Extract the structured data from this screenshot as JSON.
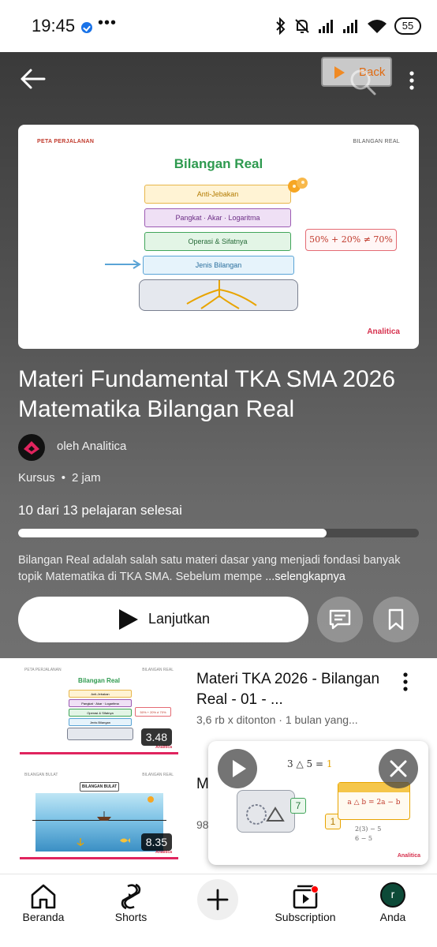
{
  "status_bar": {
    "time": "19:45",
    "more": "•••",
    "battery": "55"
  },
  "hero": {
    "back_chip_label": "Back",
    "thumbnail": {
      "caption_left": "PETA PERJALANAN",
      "caption_right": "BILANGAN REAL",
      "title": "Bilangan Real",
      "layers": [
        "Anti-Jebakan",
        "Pangkat · Akar · Logaritma",
        "Operasi & Sifatnya",
        "Jenis Bilangan"
      ],
      "equation": "50% + 20% ≠ 70%",
      "logo": "Analitica"
    },
    "title": "Materi Fundamental TKA SMA 2026 Matematika Bilangan Real",
    "author": "oleh Analitica",
    "type": "Kursus",
    "separator": "•",
    "duration": "2 jam",
    "progress_label": "10 dari 13 pelajaran selesai",
    "progress_fraction": 0.77,
    "description": "Bilangan Real adalah salah satu materi dasar yang menjadi fondasi banyak topik Matematika di TKA SMA. Sebelum mempe",
    "description_more": "...selengkapnya",
    "resume_label": "Lanjutkan"
  },
  "lessons": [
    {
      "title": "Materi TKA 2026 - Bilangan Real - 01 - ...",
      "meta": "3,6 rb x ditonton · 1 bulan yang...",
      "duration": "3.48",
      "thumb_title": "Bilangan Real",
      "thumb_cap_left": "PETA PERJALANAN",
      "thumb_cap_right": "BILANGAN REAL",
      "thumb_layers": [
        "Anti-Jebakan",
        "Pangkat · Akar · Logaritma",
        "Operasi & Sifatnya",
        "Jenis Bilangan"
      ],
      "thumb_equation": "50% + 20% ≠ 70%",
      "thumb_logo": "Analitica"
    },
    {
      "title": "M B",
      "meta": "98",
      "duration": "8.35",
      "thumb_title": "BILANGAN BULAT",
      "thumb_cap_left": "BILANGAN BULAT",
      "thumb_cap_right": "BILANGAN REAL",
      "thumb_logo": "Analitica"
    }
  ],
  "mini_player": {
    "equation": "3 △ 5 =",
    "answer": "1",
    "seven": "7",
    "one": "1",
    "card_formula": "a △ b = 2a − b",
    "step1": "2(3) − 5",
    "step2": "6 − 5",
    "logo": "Analitica"
  },
  "nav": {
    "home": "Beranda",
    "shorts": "Shorts",
    "subscription": "Subscription",
    "you": "Anda",
    "avatar_letter": "r"
  },
  "colors": {
    "accent": "#ff0000",
    "brand": "#d6304d",
    "progress": "#ffffff"
  }
}
